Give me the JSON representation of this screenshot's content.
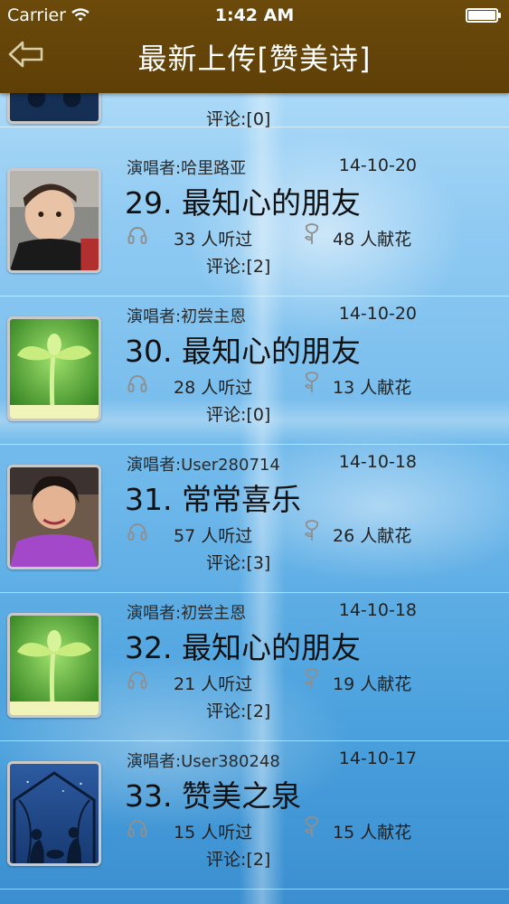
{
  "status_bar": {
    "carrier": "Carrier",
    "time": "1:42 AM"
  },
  "nav": {
    "title": "最新上传[赞美诗]",
    "back_icon": "back-arrow-icon"
  },
  "partial_row": {
    "comments": "评论:[0]"
  },
  "rows": [
    {
      "singer": "演唱者:哈里路亚",
      "date": "14-10-20",
      "title": "29. 最知心的朋友",
      "listens": "33 人听过",
      "flowers": "48 人献花",
      "comments": "评论:[2]",
      "thumb": "baby-photo"
    },
    {
      "singer": "演唱者:初尝主恩",
      "date": "14-10-20",
      "title": "30. 最知心的朋友",
      "listens": "28 人听过",
      "flowers": "13 人献花",
      "comments": "评论:[0]",
      "thumb": "sprout-photo"
    },
    {
      "singer": "演唱者:User280714",
      "date": "14-10-18",
      "title": "31. 常常喜乐",
      "listens": "57 人听过",
      "flowers": "26 人献花",
      "comments": "评论:[3]",
      "thumb": "woman-photo"
    },
    {
      "singer": "演唱者:初尝主恩",
      "date": "14-10-18",
      "title": "32. 最知心的朋友",
      "listens": "21 人听过",
      "flowers": "19 人献花",
      "comments": "评论:[2]",
      "thumb": "sprout-photo"
    },
    {
      "singer": "演唱者:User380248",
      "date": "14-10-17",
      "title": "33. 赞美之泉",
      "listens": "15 人听过",
      "flowers": "15 人献花",
      "comments": "评论:[2]",
      "thumb": "nativity-photo"
    }
  ],
  "icons": {
    "listen": "headphones-icon",
    "flower": "rose-icon"
  },
  "colors": {
    "nav_bg": "#5e3f06",
    "text": "#222222"
  }
}
